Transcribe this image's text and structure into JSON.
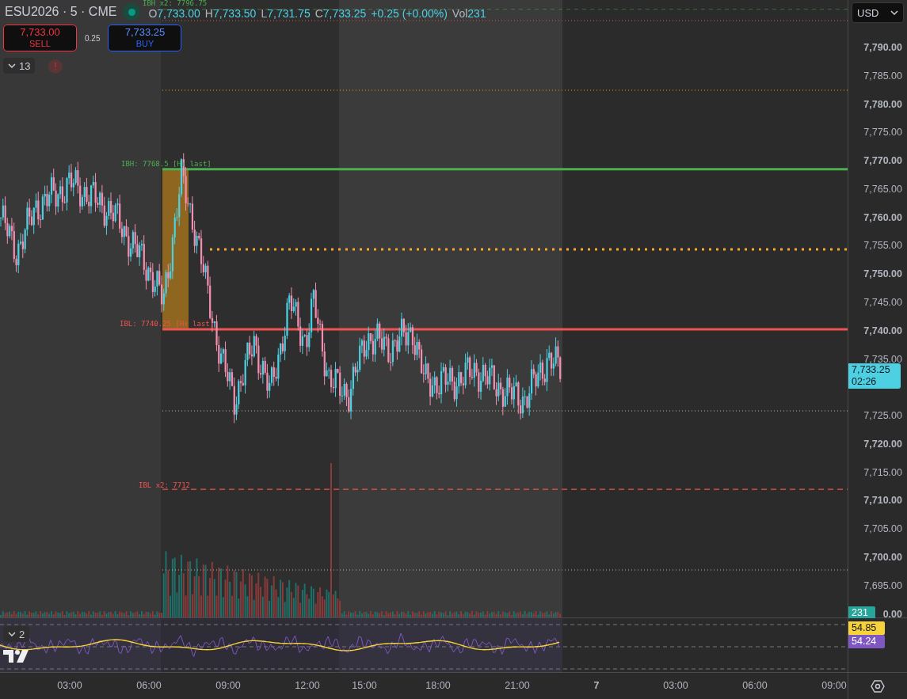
{
  "symbol": {
    "title": "ESU2026 · 5 · CME",
    "market_open": true
  },
  "legend": {
    "ohlc": [
      {
        "label": "O",
        "value": "7,733.00"
      },
      {
        "label": "H",
        "value": "7,733.50"
      },
      {
        "label": "L",
        "value": "7,731.75"
      },
      {
        "label": "C",
        "value": "7,733.25"
      }
    ],
    "change": "+0.25 (+0.00%)",
    "volume_label": "Vol",
    "volume_value": "231"
  },
  "trade": {
    "sell": {
      "price": "7,733.00",
      "label": "SELL"
    },
    "spread": "0.25",
    "buy": {
      "price": "7,733.25",
      "label": "BUY"
    }
  },
  "indicators_toggle": {
    "count": "13"
  },
  "levels": [
    {
      "label": "IBH x2: 7796.75",
      "kind": "faint",
      "color": "#4caf50"
    },
    {
      "label": "IBH: 7768.5 [H↑ last]",
      "kind": "solid",
      "color": "#4caf50"
    },
    {
      "label": "IBL: 7740.25 [H↑ last]",
      "kind": "solid",
      "color": "#f05350"
    },
    {
      "label": "IBL x2: 7712",
      "kind": "dashed",
      "color": "#f05350"
    }
  ],
  "price_axis": {
    "currency": "USD",
    "ticks": [
      {
        "text": "7,790.00",
        "major": true
      },
      {
        "text": "7,785.00",
        "major": false
      },
      {
        "text": "7,780.00",
        "major": true
      },
      {
        "text": "7,775.00",
        "major": false
      },
      {
        "text": "7,770.00",
        "major": true
      },
      {
        "text": "7,765.00",
        "major": false
      },
      {
        "text": "7,760.00",
        "major": true
      },
      {
        "text": "7,755.00",
        "major": false
      },
      {
        "text": "7,750.00",
        "major": true
      },
      {
        "text": "7,745.00",
        "major": false
      },
      {
        "text": "7,740.00",
        "major": true
      },
      {
        "text": "7,735.00",
        "major": false
      },
      {
        "text": "7,725.00",
        "major": false
      },
      {
        "text": "7,720.00",
        "major": true
      },
      {
        "text": "7,715.00",
        "major": false
      },
      {
        "text": "7,710.00",
        "major": true
      },
      {
        "text": "7,705.00",
        "major": false
      },
      {
        "text": "7,700.00",
        "major": true
      },
      {
        "text": "7,695.00",
        "major": false
      },
      {
        "text": "0.00",
        "major": true
      }
    ],
    "last_price": {
      "value": "7,733.25",
      "countdown": "02:26"
    },
    "volume_badge": "231"
  },
  "oscillator": {
    "count": "2",
    "values": [
      {
        "value": "54.85",
        "color": "#f7d23a"
      },
      {
        "value": "54.24",
        "color": "#7e57c2"
      }
    ]
  },
  "time_axis": [
    {
      "text": "03:00",
      "major": false
    },
    {
      "text": "06:00",
      "major": false
    },
    {
      "text": "09:00",
      "major": false
    },
    {
      "text": "12:00",
      "major": false
    },
    {
      "text": "15:00",
      "major": false
    },
    {
      "text": "18:00",
      "major": false
    },
    {
      "text": "21:00",
      "major": false
    },
    {
      "text": "7",
      "major": true
    },
    {
      "text": "03:00",
      "major": false
    },
    {
      "text": "06:00",
      "major": false
    },
    {
      "text": "09:00",
      "major": false
    }
  ]
}
